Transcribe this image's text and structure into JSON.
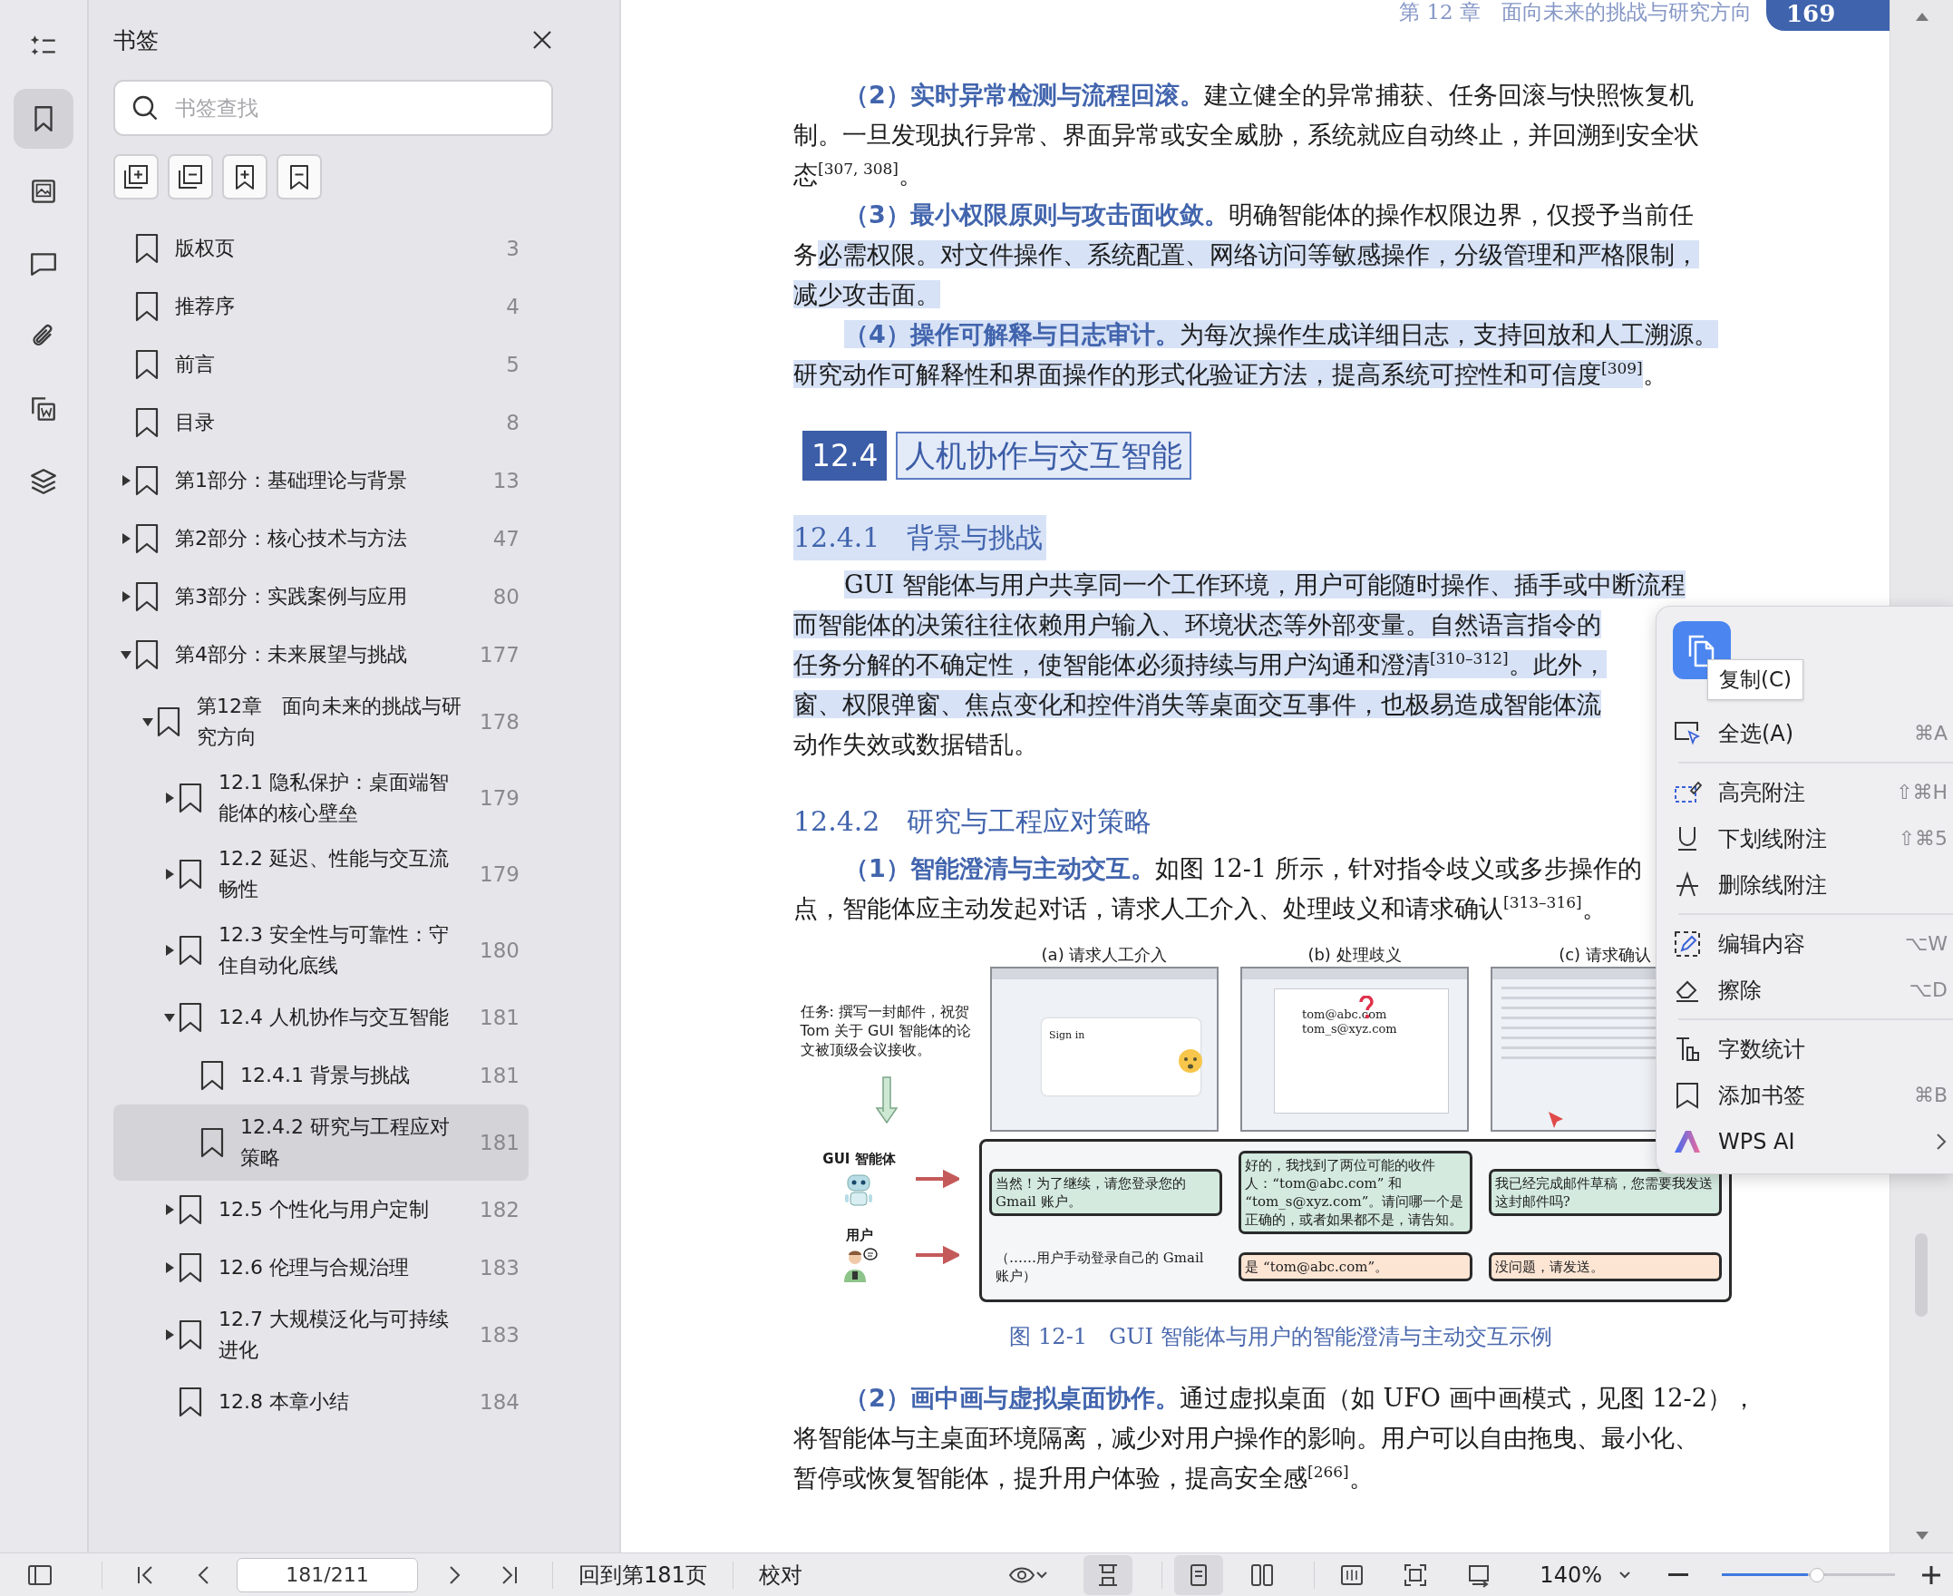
{
  "rail": [
    {
      "selected": false
    },
    {
      "selected": true
    },
    {
      "selected": false
    },
    {
      "selected": false
    },
    {
      "selected": false
    },
    {
      "selected": false
    },
    {
      "selected": false
    }
  ],
  "sidebar": {
    "title": "书签",
    "search": {
      "placeholder": "书签查找"
    },
    "items": [
      {
        "title": "版权页",
        "page": "3",
        "selected": false
      },
      {
        "title": "推荐序",
        "page": "4",
        "selected": false
      },
      {
        "title": "前言",
        "page": "5",
        "selected": false
      },
      {
        "title": "目录",
        "page": "8",
        "selected": false
      },
      {
        "title": "第1部分：基础理论与背景",
        "page": "13",
        "selected": false,
        "expanded": false
      },
      {
        "title": "第2部分：核心技术与方法",
        "page": "47",
        "selected": false,
        "expanded": false
      },
      {
        "title": "第3部分：实践案例与应用",
        "page": "80",
        "selected": false,
        "expanded": false
      },
      {
        "title": "第4部分：未来展望与挑战",
        "page": "177",
        "selected": false,
        "expanded": true,
        "children": [
          {
            "title": "第12章　面向未来的挑战与研究方向",
            "page": "178",
            "selected": false,
            "expanded": true,
            "children": [
              {
                "title": "12.1 隐私保护：桌面端智能体的核心壁垒",
                "page": "179",
                "selected": false,
                "expanded": false
              },
              {
                "title": "12.2 延迟、性能与交互流畅性",
                "page": "179",
                "selected": false,
                "expanded": false
              },
              {
                "title": "12.3 安全性与可靠性：守住自动化底线",
                "page": "180",
                "selected": false,
                "expanded": false
              },
              {
                "title": "12.4 人机协作与交互智能",
                "page": "181",
                "selected": false,
                "expanded": true,
                "children": [
                  {
                    "title": "12.4.1 背景与挑战",
                    "page": "181",
                    "selected": false
                  },
                  {
                    "title": "12.4.2 研究与工程应对策略",
                    "page": "181",
                    "selected": true
                  }
                ]
              },
              {
                "title": "12.5 个性化与用户定制",
                "page": "182",
                "selected": false,
                "expanded": false
              },
              {
                "title": "12.6 伦理与合规治理",
                "page": "183",
                "selected": false,
                "expanded": false
              },
              {
                "title": "12.7 大规模泛化与可持续进化",
                "page": "183",
                "selected": false,
                "expanded": false
              },
              {
                "title": "12.8 本章小结",
                "page": "184",
                "selected": false
              }
            ]
          }
        ]
      }
    ]
  },
  "page": {
    "header": "第 12 章　面向未来的挑战与研究方向",
    "page_number": "169",
    "blocks": [
      {
        "kind": "paragraph",
        "lines": [
          [
            {
              "text": "（2）实时异常检测与流程回滚。",
              "kind": "lead",
              "selected": false
            },
            {
              "text": "建立健全的异常捕获、任务回滚与快照恢复机",
              "kind": "body",
              "selected": false
            }
          ],
          [
            {
              "text": "制。一旦发现执行异常、界面异常或安全威胁，系统就应自动终止，并回溯到安全状",
              "kind": "body",
              "selected": false
            }
          ],
          [
            {
              "text": "态$^{[307, 308]}$。",
              "kind": "body",
              "selected": false
            }
          ]
        ]
      },
      {
        "kind": "paragraph",
        "lines": [
          [
            {
              "text": "（3）最小权限原则与攻击面收敛。",
              "kind": "lead",
              "selected": false
            },
            {
              "text": "明确智能体的操作权限边界，仅授予当前任",
              "kind": "body",
              "selected": false
            }
          ],
          [
            {
              "text": "务",
              "kind": "body",
              "selected": false
            },
            {
              "text": "必需权限。对文件操作、系统配置、网络访问等敏感操作，分级管理和严格限制，",
              "kind": "body",
              "selected": true
            }
          ],
          [
            {
              "text": "减少攻击面。",
              "kind": "body",
              "selected": true
            }
          ]
        ]
      },
      {
        "kind": "paragraph",
        "lines": [
          [
            {
              "text": "（4）操作可解释与日志审计。",
              "kind": "lead",
              "selected": true
            },
            {
              "text": "为每次操作生成详细日志，支持回放和人工溯源。",
              "kind": "body",
              "selected": true
            }
          ],
          [
            {
              "text": "研究动作可解释性和界面操作的形式化验证方法，提高系统可控性和可信度$^{[309]}$",
              "kind": "body",
              "selected": true
            },
            {
              "text": "。",
              "kind": "body",
              "selected": false
            }
          ]
        ]
      },
      {
        "kind": "section",
        "number": "12.4",
        "title": "人机协作与交互智能",
        "selected": true
      },
      {
        "kind": "subsection",
        "number": "12.4.1",
        "title": "背景与挑战",
        "selected": true
      },
      {
        "kind": "paragraph",
        "lines": [
          [
            {
              "text": "GUI 智能体与用户共享同一个工作环境，用户可能随时操作、插手或中断流程",
              "kind": "body",
              "selected": true
            }
          ],
          [
            {
              "text": "而智能体的决策往往依赖用户输入、环境状态等外部变量。自然语言指令的",
              "kind": "body",
              "selected": true
            }
          ],
          [
            {
              "text": "任务分解的不确定性，使智能体必须持续与用户沟通和澄清$^{[310–312]}$。此外，",
              "kind": "body",
              "selected": true
            }
          ],
          [
            {
              "text": "窗、权限弹窗、焦点变化和控件消失等桌面交互事件，也极易造成智能体流",
              "kind": "body",
              "selected": true
            }
          ],
          [
            {
              "text": "动作失效或数据错乱。",
              "kind": "body",
              "selected": false
            }
          ]
        ]
      },
      {
        "kind": "subsection",
        "number": "12.4.2",
        "title": "研究与工程应对策略",
        "selected": false
      },
      {
        "kind": "paragraph",
        "lines": [
          [
            {
              "text": "（1）智能澄清与主动交互。",
              "kind": "lead",
              "selected": false
            },
            {
              "text": "如图 12-1 所示，针对指令歧义或多步操作的",
              "kind": "body",
              "selected": false
            }
          ],
          [
            {
              "text": "点，智能体应主动发起对话，请求人工介入、处理歧义和请求确认$^{[313–316]}$。",
              "kind": "body",
              "selected": false
            }
          ]
        ]
      },
      {
        "kind": "figure",
        "task": "任务: 撰写一封邮件，祝贺Tom 关于 GUI 智能体的论文被顶级会议接收。",
        "panels": [
          {
            "caption": "(a) 请求人工介入",
            "texts": [
              "Sign in"
            ]
          },
          {
            "caption": "(b) 处理歧义",
            "texts": [
              "tom@abc.com",
              "tom_s@xyz.com"
            ]
          },
          {
            "caption": "(c) 请求确认"
          }
        ],
        "rows": [
          {
            "speaker": "GUI 智能体",
            "kind": "agent",
            "messages": [
              {
                "text": "当然！为了继续，请您登录您的 Gmail 账户。",
                "kind": "bubble"
              },
              {
                "text": "好的，我找到了两位可能的收件人：“tom@abc.com” 和 “tom_s@xyz.com”。请问哪一个是正确的，或者如果都不是，请告知。",
                "kind": "bubble"
              },
              {
                "text": "我已经完成邮件草稿，您需要我发送这封邮件吗?",
                "kind": "bubble"
              }
            ]
          },
          {
            "speaker": "用户",
            "kind": "user",
            "messages": [
              {
                "text": "（……用户手动登录自己的 Gmail 账户）",
                "kind": "plain"
              },
              {
                "text": "是 “tom@abc.com”。",
                "kind": "bubble"
              },
              {
                "text": "没问题，请发送。",
                "kind": "bubble"
              }
            ]
          }
        ],
        "caption": "图 12-1　GUI 智能体与用户的智能澄清与主动交互示例"
      },
      {
        "kind": "paragraph",
        "lines": [
          [
            {
              "text": "（2）画中画与虚拟桌面协作。",
              "kind": "lead",
              "selected": false
            },
            {
              "text": "通过虚拟桌面（如 UFO 画中画模式，见图 12-2），",
              "kind": "body",
              "selected": false
            }
          ],
          [
            {
              "text": "将智能体与主桌面环境隔离，减少对用户操作的影响。用户可以自由拖曳、最小化、",
              "kind": "body",
              "selected": false
            }
          ],
          [
            {
              "text": "暂停或恢复智能体，提升用户体验，提高安全感$^{[266]}$。",
              "kind": "body",
              "selected": false
            }
          ]
        ]
      }
    ]
  },
  "context_menu": {
    "copy_button": {
      "selected": true
    },
    "tooltip": "复制(C)",
    "groups": [
      [
        {
          "label": "全选(A)",
          "shortcut": "⌘A"
        }
      ],
      [
        {
          "label": "高亮附注",
          "shortcut": "⇧⌘H"
        },
        {
          "label": "下划线附注",
          "shortcut": "⇧⌘5"
        },
        {
          "label": "删除线附注"
        }
      ],
      [
        {
          "label": "编辑内容",
          "shortcut": "⌥W"
        },
        {
          "label": "擦除",
          "shortcut": "⌥D"
        }
      ],
      [
        {
          "label": "字数统计"
        },
        {
          "label": "添加书签",
          "shortcut": "⌘B"
        },
        {
          "label": "WPS AI",
          "submenu": true
        }
      ]
    ]
  },
  "status_bar": {
    "page_field": "181/211",
    "goto_button": "回到第181页",
    "proofread": "校对",
    "view_modes": [
      {
        "selected": true
      },
      {
        "selected": true
      },
      {
        "selected": false
      },
      {
        "selected": false
      },
      {
        "selected": false
      },
      {
        "selected": false
      }
    ],
    "zoom": "140%",
    "zoom_slider": {
      "level": 0.5
    }
  }
}
